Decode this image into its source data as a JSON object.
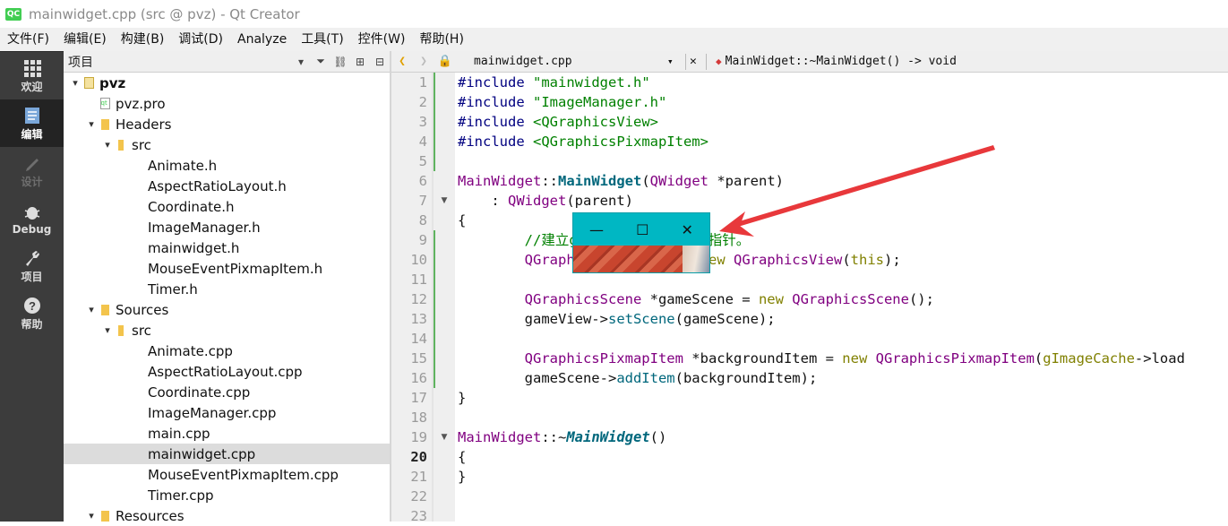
{
  "window": {
    "title": "mainwidget.cpp (src @ pvz) - Qt Creator",
    "app_badge": "QC"
  },
  "menu": [
    "文件(F)",
    "编辑(E)",
    "构建(B)",
    "调试(D)",
    "Analyze",
    "工具(T)",
    "控件(W)",
    "帮助(H)"
  ],
  "modes": [
    {
      "label": "欢迎",
      "icon": "grid-icon",
      "state": "normal"
    },
    {
      "label": "编辑",
      "icon": "edit-icon",
      "state": "active"
    },
    {
      "label": "设计",
      "icon": "pencil-icon",
      "state": "disabled"
    },
    {
      "label": "Debug",
      "icon": "bug-icon",
      "state": "normal"
    },
    {
      "label": "项目",
      "icon": "wrench-icon",
      "state": "normal"
    },
    {
      "label": "帮助",
      "icon": "help-icon",
      "state": "normal"
    }
  ],
  "project_panel": {
    "title": "项目",
    "tree": [
      {
        "label": "pvz",
        "depth": 0,
        "expander": "▾",
        "icon": "project-icon",
        "bold": true
      },
      {
        "label": "pvz.pro",
        "depth": 1,
        "expander": "",
        "icon": "pro-file-icon"
      },
      {
        "label": "Headers",
        "depth": 1,
        "expander": "▾",
        "icon": "headers-folder-icon"
      },
      {
        "label": "src",
        "depth": 2,
        "expander": "▾",
        "icon": "folder-icon"
      },
      {
        "label": "Animate.h",
        "depth": 3,
        "expander": "",
        "icon": ""
      },
      {
        "label": "AspectRatioLayout.h",
        "depth": 3,
        "expander": "",
        "icon": ""
      },
      {
        "label": "Coordinate.h",
        "depth": 3,
        "expander": "",
        "icon": ""
      },
      {
        "label": "ImageManager.h",
        "depth": 3,
        "expander": "",
        "icon": ""
      },
      {
        "label": "mainwidget.h",
        "depth": 3,
        "expander": "",
        "icon": ""
      },
      {
        "label": "MouseEventPixmapItem.h",
        "depth": 3,
        "expander": "",
        "icon": ""
      },
      {
        "label": "Timer.h",
        "depth": 3,
        "expander": "",
        "icon": ""
      },
      {
        "label": "Sources",
        "depth": 1,
        "expander": "▾",
        "icon": "sources-folder-icon"
      },
      {
        "label": "src",
        "depth": 2,
        "expander": "▾",
        "icon": "folder-icon"
      },
      {
        "label": "Animate.cpp",
        "depth": 3,
        "expander": "",
        "icon": ""
      },
      {
        "label": "AspectRatioLayout.cpp",
        "depth": 3,
        "expander": "",
        "icon": ""
      },
      {
        "label": "Coordinate.cpp",
        "depth": 3,
        "expander": "",
        "icon": ""
      },
      {
        "label": "ImageManager.cpp",
        "depth": 3,
        "expander": "",
        "icon": ""
      },
      {
        "label": "main.cpp",
        "depth": 3,
        "expander": "",
        "icon": ""
      },
      {
        "label": "mainwidget.cpp",
        "depth": 3,
        "expander": "",
        "icon": "",
        "selected": true
      },
      {
        "label": "MouseEventPixmapItem.cpp",
        "depth": 3,
        "expander": "",
        "icon": ""
      },
      {
        "label": "Timer.cpp",
        "depth": 3,
        "expander": "",
        "icon": ""
      },
      {
        "label": "Resources",
        "depth": 1,
        "expander": "▾",
        "icon": "resources-folder-icon"
      }
    ]
  },
  "editor": {
    "file_name": "mainwidget.cpp",
    "symbol": "MainWidget::~MainWidget() -> void",
    "current_line": 20,
    "lines": [
      [
        [
          "pp",
          "#include "
        ],
        [
          "str",
          "\"mainwidget.h\""
        ]
      ],
      [
        [
          "pp",
          "#include "
        ],
        [
          "str",
          "\"ImageManager.h\""
        ]
      ],
      [
        [
          "pp",
          "#include "
        ],
        [
          "str",
          "<QGraphicsView>"
        ]
      ],
      [
        [
          "pp",
          "#include "
        ],
        [
          "str",
          "<QGraphicsPixmapItem>"
        ]
      ],
      [],
      [
        [
          "cls",
          "MainWidget"
        ],
        [
          "",
          "::"
        ],
        [
          "fnb",
          "MainWidget"
        ],
        [
          "",
          "("
        ],
        [
          "cls",
          "QWidget"
        ],
        [
          "",
          " *parent)"
        ]
      ],
      [
        [
          "",
          "    : "
        ],
        [
          "cls",
          "QWidget"
        ],
        [
          "",
          "(parent)"
        ]
      ],
      [
        [
          "",
          "{"
        ]
      ],
      [
        [
          "",
          "        "
        ],
        [
          "cm",
          "//建立g"
        ],
        [
          "",
          "          "
        ],
        [
          "cm",
          "入this指针。"
        ]
      ],
      [
        [
          "",
          "        "
        ],
        [
          "cls",
          "QGraph"
        ],
        [
          "",
          "          "
        ],
        [
          "",
          "ew = "
        ],
        [
          "kw",
          "new "
        ],
        [
          "cls",
          "QGraphicsView"
        ],
        [
          "",
          "("
        ],
        [
          "kw",
          "this"
        ],
        [
          "",
          ");"
        ]
      ],
      [],
      [
        [
          "",
          "        "
        ],
        [
          "cls",
          "QGraphicsScene"
        ],
        [
          "",
          " *gameScene = "
        ],
        [
          "kw",
          "new "
        ],
        [
          "cls",
          "QGraphicsScene"
        ],
        [
          "",
          "();"
        ]
      ],
      [
        [
          "",
          "        gameView->"
        ],
        [
          "fn",
          "setScene"
        ],
        [
          "",
          "(gameScene);"
        ]
      ],
      [],
      [
        [
          "",
          "        "
        ],
        [
          "cls",
          "QGraphicsPixmapItem"
        ],
        [
          "",
          " *backgroundItem = "
        ],
        [
          "kw",
          "new "
        ],
        [
          "cls",
          "QGraphicsPixmapItem"
        ],
        [
          "",
          "("
        ],
        [
          "kw",
          "gImageCache"
        ],
        [
          "",
          "->load"
        ]
      ],
      [
        [
          "",
          "        gameScene->"
        ],
        [
          "fn",
          "addItem"
        ],
        [
          "",
          "(backgroundItem);"
        ]
      ],
      [
        [
          "",
          "}"
        ]
      ],
      [],
      [
        [
          "cls",
          "MainWidget"
        ],
        [
          "",
          "::~"
        ],
        [
          "fni",
          "MainWidget"
        ],
        [
          "",
          "()"
        ]
      ],
      [
        [
          "",
          "{"
        ]
      ],
      [
        [
          "",
          "}"
        ]
      ],
      [],
      []
    ]
  },
  "popup": {
    "buttons": [
      "minimize-icon",
      "maximize-icon",
      "close-icon"
    ],
    "title_color": "#00b7c3"
  },
  "annotation": {
    "color": "#e8383b"
  }
}
